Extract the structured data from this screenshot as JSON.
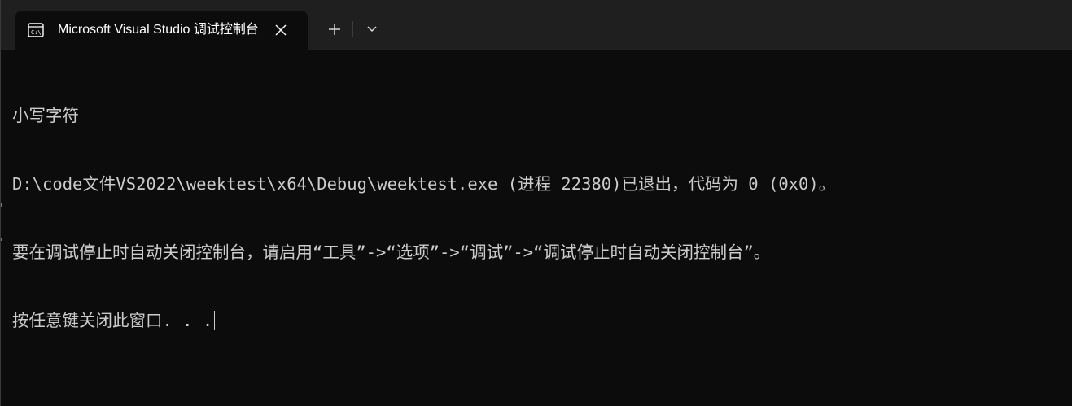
{
  "window": {
    "tab": {
      "title": "Microsoft Visual Studio 调试控制台",
      "icon": "console-icon",
      "close_icon": "close-icon"
    },
    "new_tab_icon": "plus-icon",
    "dropdown_icon": "chevron-down-icon"
  },
  "terminal": {
    "lines": [
      "小写字符",
      "D:\\code文件VS2022\\weektest\\x64\\Debug\\weektest.exe (进程 22380)已退出，代码为 0 (0x0)。",
      "要在调试停止时自动关闭控制台，请启用“工具”->“选项”->“调试”->“调试停止时自动关闭控制台”。",
      "按任意键关闭此窗口. . ."
    ],
    "colors": {
      "background": "#0c0c0c",
      "foreground": "#cccccc",
      "titlebar": "#1f1f1f"
    }
  }
}
